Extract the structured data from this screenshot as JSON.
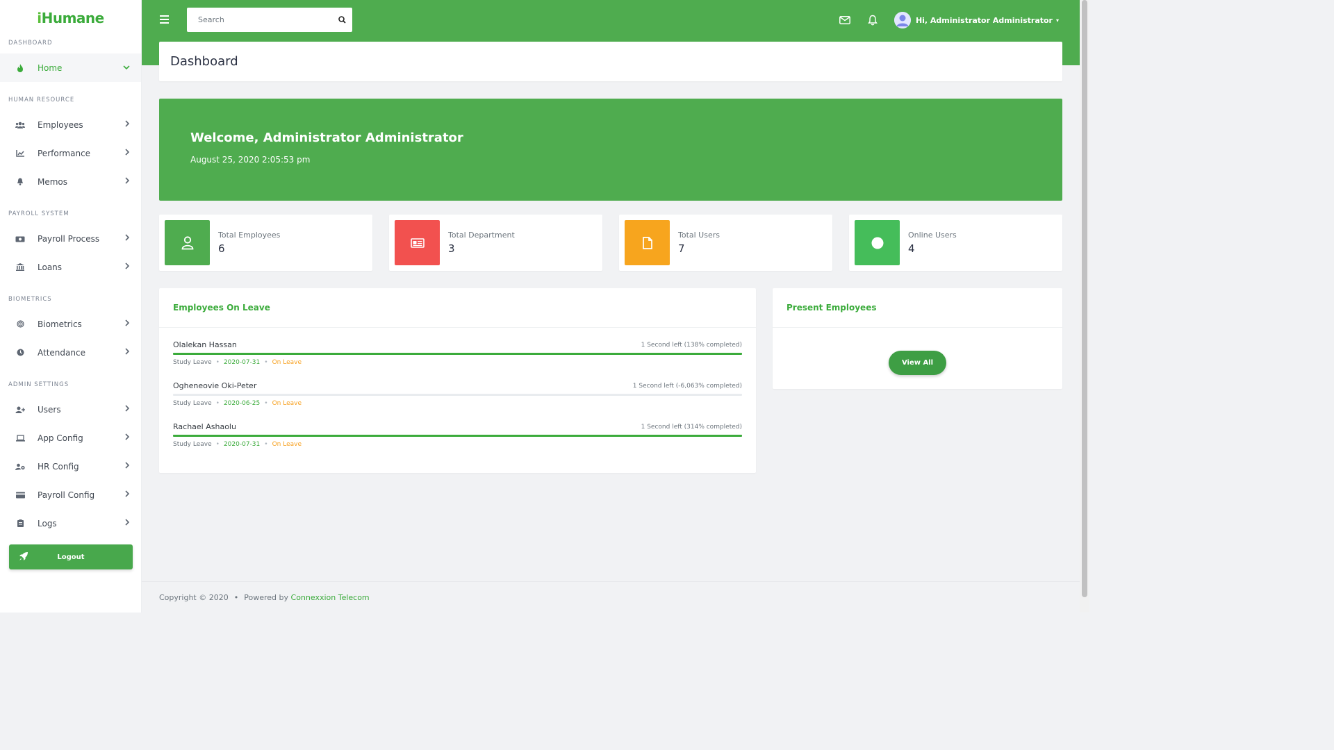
{
  "brand": {
    "logo_prefix": "i",
    "logo_text": "Humane"
  },
  "sidebar": {
    "sections": {
      "dashboard": "DASHBOARD",
      "hr": "HUMAN RESOURCE",
      "payroll": "PAYROLL SYSTEM",
      "biometrics": "BIOMETRICS",
      "admin": "ADMIN SETTINGS"
    },
    "items": {
      "home": "Home",
      "employees": "Employees",
      "performance": "Performance",
      "memos": "Memos",
      "payroll_process": "Payroll Process",
      "loans": "Loans",
      "biometrics": "Biometrics",
      "attendance": "Attendance",
      "users": "Users",
      "app_config": "App Config",
      "hr_config": "HR Config",
      "payroll_config": "Payroll Config",
      "logs": "Logs"
    },
    "logout": "Logout"
  },
  "topbar": {
    "search_placeholder": "Search",
    "greeting": "Hi, Administrator Administrator"
  },
  "page": {
    "title": "Dashboard",
    "welcome_title": "Welcome, Administrator Administrator",
    "welcome_datetime": "August 25, 2020 2:05:53 pm"
  },
  "stats": [
    {
      "label": "Total Employees",
      "value": "6",
      "color": "#4fac4f",
      "icon": "user-icon"
    },
    {
      "label": "Total Department",
      "value": "3",
      "color": "#f2514f",
      "icon": "id-card-icon"
    },
    {
      "label": "Total Users",
      "value": "7",
      "color": "#f7a51e",
      "icon": "file-icon"
    },
    {
      "label": "Online Users",
      "value": "4",
      "color": "#45bd5a",
      "icon": "circle-icon"
    }
  ],
  "leave": {
    "title": "Employees On Leave",
    "rows": [
      {
        "name": "Olalekan Hassan",
        "progress_text": "1 Second left (138% completed)",
        "progress": 1.0,
        "type": "Study Leave",
        "date": "2020-07-31",
        "status": "On Leave"
      },
      {
        "name": "Ogheneovie Oki-Peter",
        "progress_text": "1 Second left (-6,063% completed)",
        "progress": 0.0,
        "type": "Study Leave",
        "date": "2020-06-25",
        "status": "On Leave"
      },
      {
        "name": "Rachael Ashaolu",
        "progress_text": "1 Second left (314% completed)",
        "progress": 1.0,
        "type": "Study Leave",
        "date": "2020-07-31",
        "status": "On Leave"
      }
    ]
  },
  "present": {
    "title": "Present Employees",
    "view_all": "View All"
  },
  "footer": {
    "copyright": "Copyright © 2020",
    "powered": "Powered by",
    "company": "Connexxion Telecom"
  },
  "colors": {
    "accent": "#4fac4f",
    "warning": "#f7a01e"
  }
}
